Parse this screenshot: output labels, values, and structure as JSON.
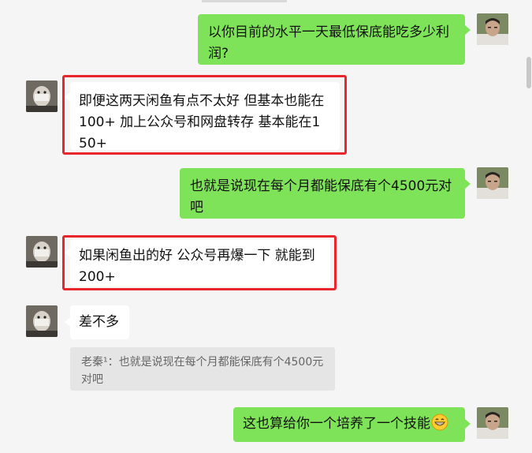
{
  "messages": [
    {
      "side": "me",
      "text": "以你目前的水平一天最低保底能吃多少利润?"
    },
    {
      "side": "other",
      "text": "即便这两天闲鱼有点不太好 但基本也能在100+ 加上公众号和网盘转存  基本能在150+",
      "highlighted": true
    },
    {
      "side": "me",
      "text": "也就是说现在每个月都能保底有个4500元对吧"
    },
    {
      "side": "other",
      "text": "如果闲鱼出的好 公众号再爆一下  就能到200+",
      "highlighted": true
    },
    {
      "side": "other",
      "text": "差不多"
    },
    {
      "side": "quote",
      "text": "老秦¹：也就是说现在每个月都能保底有个4500元对吧"
    },
    {
      "side": "me",
      "text": "这也算给你一个培养了一个技能",
      "emoji": "grinning-emoji"
    }
  ],
  "colors": {
    "my_bubble": "#7fe359",
    "their_bubble": "#ffffff",
    "highlight_border": "#e8262b",
    "background": "#f5f5f5"
  }
}
